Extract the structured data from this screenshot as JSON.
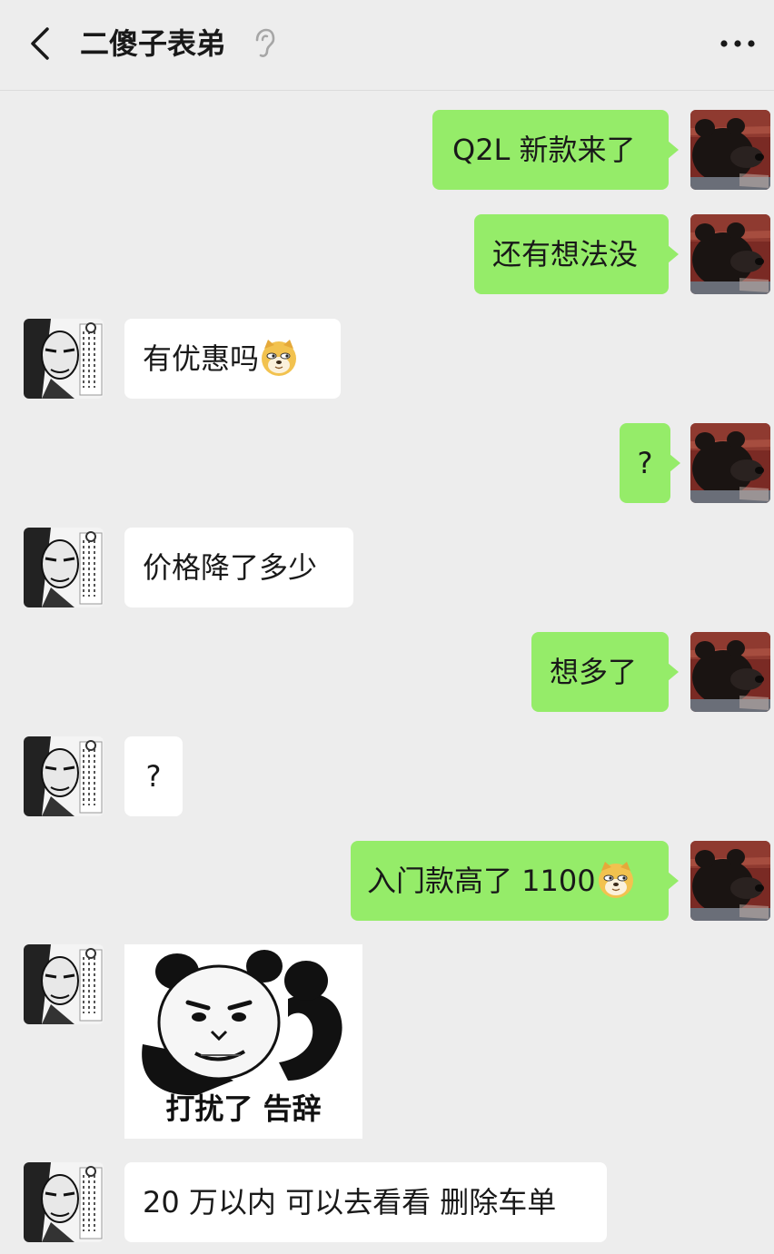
{
  "header": {
    "title": "二傻子表弟"
  },
  "messages": [
    {
      "from": "me",
      "text": "Q2L 新款来了"
    },
    {
      "from": "me",
      "text": "还有想法没"
    },
    {
      "from": "them",
      "text": "有优惠吗",
      "emoji": "doge-emoji"
    },
    {
      "from": "me",
      "text": "?"
    },
    {
      "from": "them",
      "text": "价格降了多少"
    },
    {
      "from": "me",
      "text": "想多了"
    },
    {
      "from": "them",
      "text": "?"
    },
    {
      "from": "me",
      "text": "入门款高了 1100",
      "emoji": "doge-emoji"
    },
    {
      "from": "them",
      "type": "sticker",
      "caption": "打扰了 告辞"
    },
    {
      "from": "them",
      "text": "20 万以内 可以去看看 删除车单"
    }
  ],
  "colors": {
    "my_bubble": "#95ec69",
    "their_bubble": "#ffffff",
    "background": "#ededed"
  }
}
